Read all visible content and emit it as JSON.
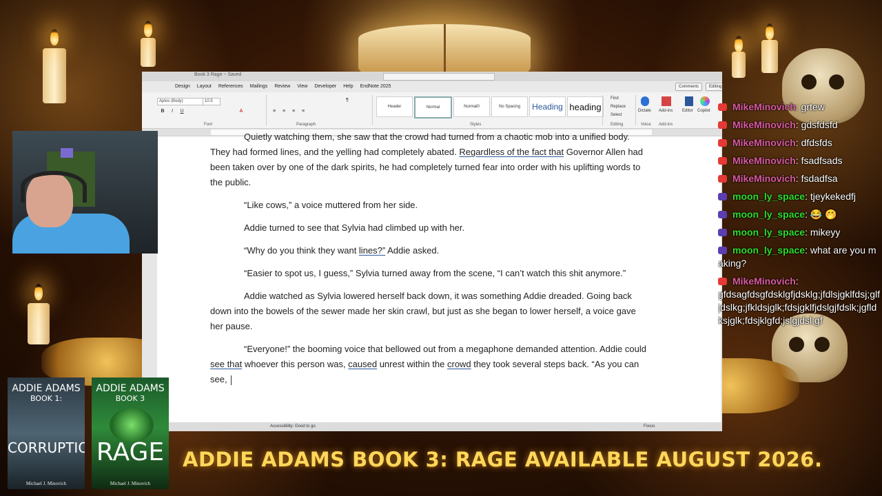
{
  "word": {
    "title": "Book 3 Rage ~ Saved",
    "tabs": [
      "Design",
      "Layout",
      "References",
      "Mailings",
      "Review",
      "View",
      "Developer",
      "Help",
      "EndNote 2025"
    ],
    "comments_label": "Comments",
    "editing_label": "Editing",
    "font_name": "Aptos (Body)",
    "font_size": "10.5",
    "styles": [
      "Header",
      "Normal",
      "Normal0",
      "No Spacing",
      "Heading",
      "heading"
    ],
    "group_labels": {
      "font": "Font",
      "paragraph": "Paragraph",
      "styles": "Styles",
      "editing": "Editing",
      "voice": "Voice",
      "addins": "Add-ins"
    },
    "editing_items": [
      "Find",
      "Replace",
      "Select"
    ],
    "ribbon_buttons": [
      "Dictate",
      "Add-ins",
      "Editor",
      "Copilot"
    ],
    "status": {
      "accessibility": "Accessibility: Good to go",
      "focus": "Focus"
    }
  },
  "document": {
    "p1_a": "Quietly watching them, she saw that the crowd had turned from a chaotic mob into a unified body. They had formed lines, and the yelling had completely abated. ",
    "p1_u": "Regardless of the fact that",
    "p1_b": " Governor Allen had been taken over by one of the dark spirits, he had completely turned fear into order with his uplifting words to the public.",
    "p2": "“Like cows,” a voice muttered from her side.",
    "p3": "Addie turned to see that Sylvia had climbed up with her.",
    "p4_a": "“Why do you think they want ",
    "p4_u": "lines?”",
    "p4_b": " Addie asked.",
    "p5": "“Easier to spot us, I guess,” Sylvia turned away from the scene, “I can’t watch this shit anymore.”",
    "p6": "Addie watched as Sylvia lowered herself back down, it was something Addie dreaded. Going back down into the bowels of the sewer made her skin crawl, but just as she began to lower herself, a voice gave her pause.",
    "p7_a": "“Everyone!” the booming voice that bellowed out from a megaphone demanded attention. Addie could ",
    "p7_u1": "see that",
    "p7_b": " whoever this person was, ",
    "p7_u2": "caused",
    "p7_c": " unrest within the ",
    "p7_u3": "crowd",
    "p7_d": " they took several steps back. “As you can see, "
  },
  "chat": [
    {
      "platform": "youtube",
      "user": "MikeMinovich",
      "text": "grtew"
    },
    {
      "platform": "youtube",
      "user": "MikeMinovich",
      "text": "gdsfdsfd"
    },
    {
      "platform": "youtube",
      "user": "MikeMinovich",
      "text": "dfdsfds"
    },
    {
      "platform": "youtube",
      "user": "MikeMinovich",
      "text": "fsadfsads"
    },
    {
      "platform": "youtube",
      "user": "MikeMinovich",
      "text": "fsdadfsa"
    },
    {
      "platform": "twitch",
      "user": "moon_ly_space",
      "text": "tjeykekedfj"
    },
    {
      "platform": "twitch",
      "user": "moon_ly_space",
      "text": "😂 🤭"
    },
    {
      "platform": "twitch",
      "user": "moon_ly_space",
      "text": "mikeyy"
    },
    {
      "platform": "twitch",
      "user": "moon_ly_space",
      "text": "what are you making?"
    },
    {
      "platform": "youtube",
      "user": "MikeMinovich",
      "text": "gfdsagfdsgfdsklgfjdsklg;jfdlsjgklfdsj;glfjdslkg;jfkldsjglk;fdsjgklfjdslgjfdslk;jgfldksjglk;fdsjklgfd;jslgjdsl;gf"
    }
  ],
  "covers": [
    {
      "title": "ADDIE ADAMS",
      "book": "BOOK 1:",
      "name": "CORRUPTION",
      "author": "Michael J. Minovich"
    },
    {
      "title": "ADDIE ADAMS",
      "book": "BOOK 3",
      "name": "RAGE",
      "author": "Michael J. Minovich"
    }
  ],
  "banner": "ADDIE ADAMS BOOK 3: RAGE AVAILABLE AUGUST 2026.",
  "colors": {
    "chat_mike": "#d95aa0",
    "chat_moon": "#2fdc2f",
    "banner": "#ffd75a",
    "youtube_badge": "#e53935",
    "twitch_badge": "#5b3fb0"
  }
}
